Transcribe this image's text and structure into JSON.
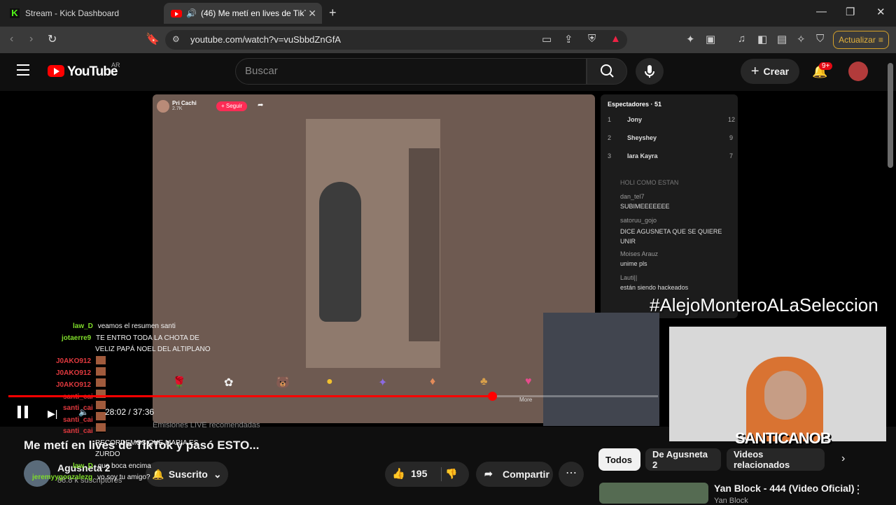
{
  "browser": {
    "tabs": [
      {
        "label": "Stream - Kick Dashboard",
        "icon": "kick-icon"
      },
      {
        "label": "(46) Me metí en lives de TikTok",
        "icon": "youtube-icon",
        "active": true
      }
    ],
    "url": "youtube.com/watch?v=vuSbbdZnGfA",
    "update_label": "Actualizar"
  },
  "youtube": {
    "logo_text": "YouTube",
    "country": "AR",
    "search_placeholder": "Buscar",
    "create_label": "Crear",
    "notifications_badge": "9+"
  },
  "tiktok_live": {
    "user": "Pri Cachi",
    "viewers_count": "2.7K",
    "follow_label": "+ Seguir",
    "viewers_title": "Espectadores · 51",
    "top_viewers": [
      {
        "rank": "1",
        "name": "Jony",
        "score": "12"
      },
      {
        "rank": "2",
        "name": "Sheyshey",
        "score": "9"
      },
      {
        "rank": "3",
        "name": "Iara Kayra",
        "score": "7"
      }
    ],
    "comments": [
      {
        "user": "",
        "text": "HOLI COMO ESTAN"
      },
      {
        "user": "dan_tel7",
        "text": "SUBIMEEEEEEE"
      },
      {
        "user": "satoruu_gojo",
        "text": "DICE AGUSNETA QUE SE QUIERE UNIR"
      },
      {
        "user": "Moises Arauz",
        "text": "unime pls"
      },
      {
        "user": "Lauti||",
        "text": "están siendo hackeados"
      }
    ],
    "more_label": "More",
    "recommended": "Emisiones LIVE recomendadas"
  },
  "overlay": {
    "hashtag": "#AlejoMonteroALaSeleccion",
    "streamer_name": "SANTICANOB"
  },
  "stream_chat": [
    {
      "user": "law_D",
      "text": "veamos el resumen santi",
      "color": "#7fdc2a"
    },
    {
      "user": "jotaerre9",
      "text": "TE ENTRO TODA LA CHOTA DE",
      "color": "#7fdc2a"
    },
    {
      "user": "",
      "text": "VELIZ PAPÁ NOEL DEL ALTIPLANO",
      "color": "#ffffff"
    },
    {
      "user": "J0AKO912",
      "text": "",
      "color": "#e0393e"
    },
    {
      "user": "J0AKO912",
      "text": "",
      "color": "#e0393e"
    },
    {
      "user": "J0AKO912",
      "text": "",
      "color": "#e0393e"
    },
    {
      "user": "santi_cai",
      "text": "",
      "color": "#e0393e"
    },
    {
      "user": "santi_cai",
      "text": "",
      "color": "#e0393e"
    },
    {
      "user": "santi_cai",
      "text": "",
      "color": "#e0393e"
    },
    {
      "user": "santi_cai",
      "text": "",
      "color": "#e0393e"
    },
    {
      "user": "",
      "text": "RECORDEMOS QUE MARIA ES",
      "color": "#ffffff"
    },
    {
      "user": "",
      "text": "ZURDO",
      "color": "#ffffff"
    },
    {
      "user": "law_D",
      "text": "que boca encima",
      "color": "#7fdc2a"
    },
    {
      "user": "jeremyygonzalezg",
      "text": "vo soy tu amigo?",
      "color": "#7fdc2a"
    }
  ],
  "player": {
    "current_time": "28:02",
    "duration": "37:36",
    "time_label": "28:02 / 37:36",
    "progress_fraction": 0.745
  },
  "video": {
    "title": "Me metí en lives de TikTok y pasó ESTO...",
    "channel": "Agusneta 2",
    "subscribers": "88.8 k suscriptores",
    "subscribed_label": "Suscrito",
    "likes": "195",
    "share_label": "Compartir"
  },
  "related": {
    "chips": [
      "Todos",
      "De Agusneta 2",
      "Videos relacionados"
    ],
    "first_video_title": "Yan Block - 444 (Video Oficial)",
    "first_video_channel": "Yan Block"
  },
  "colors": {
    "accent": "#ff0000",
    "chip_active": "#f1f1f1",
    "update": "#e3b23c"
  }
}
